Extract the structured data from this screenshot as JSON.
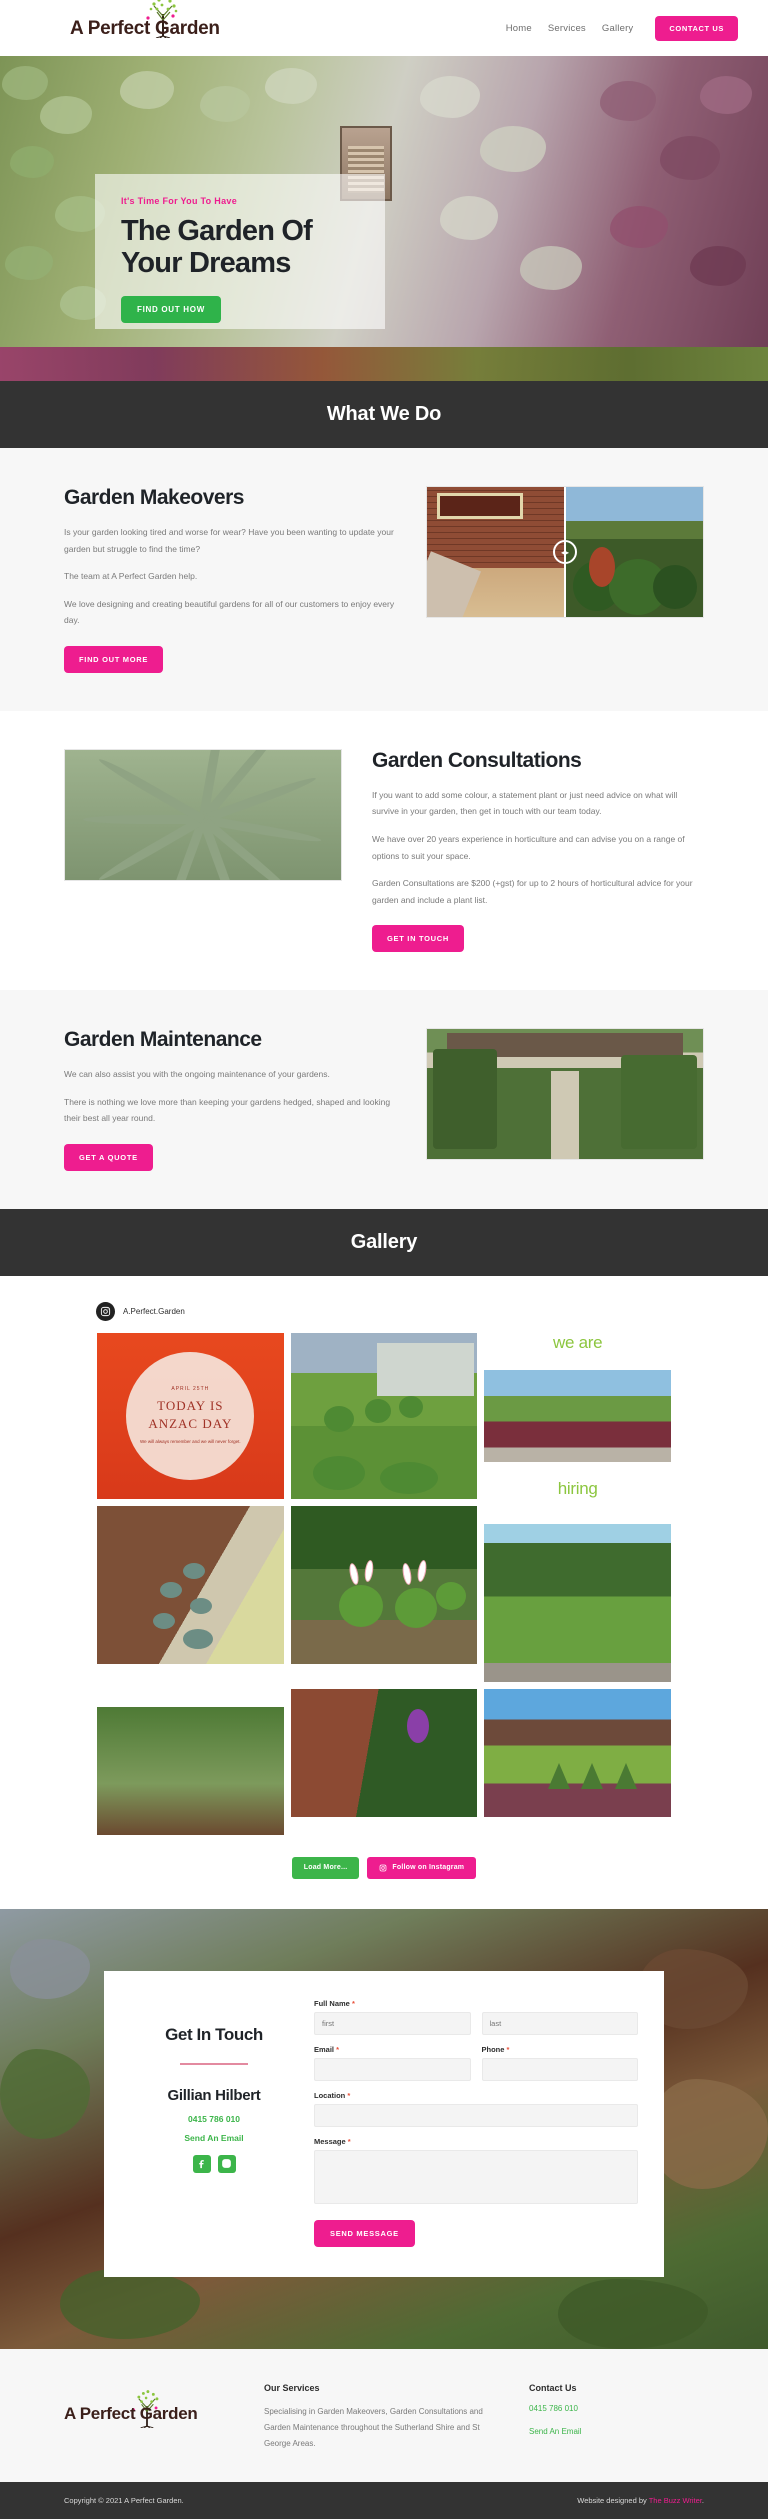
{
  "header": {
    "logo_text": "A Perfect Garden",
    "logo_icon": "tree-icon",
    "nav": [
      {
        "label": "Home"
      },
      {
        "label": "Services"
      },
      {
        "label": "Gallery"
      }
    ],
    "cta_label": "CONTACT US"
  },
  "hero": {
    "kicker": "It's Time For You To Have",
    "title_line1": "The Garden Of",
    "title_line2": "Your Dreams",
    "button_label": "FIND OUT HOW"
  },
  "what_we_do": {
    "band_title": "What We Do",
    "services": [
      {
        "heading": "Garden Makeovers",
        "paragraphs": [
          "Is your garden looking tired and worse for wear? Have you been wanting to update your garden but struggle to find the time?",
          "The team at A Perfect Garden help.",
          "We love designing and creating beautiful gardens for all of our customers to enjoy every day."
        ],
        "button_label": "FIND OUT MORE",
        "media": "before-after-slider"
      },
      {
        "heading": "Garden Consultations",
        "paragraphs": [
          "If you want to add some colour, a statement plant or just need advice on what will survive in your garden, then get in touch with our team today.",
          "We have over 20 years experience in horticulture and can advise you on a range of options to suit your space.",
          "Garden Consultations are $200 (+gst) for up to 2 hours of horticultural advice for your garden and include a plant list."
        ],
        "button_label": "GET IN TOUCH",
        "media": "palm-photo"
      },
      {
        "heading": "Garden Maintenance",
        "paragraphs": [
          "We can also assist you with the ongoing maintenance of your gardens.",
          "There is nothing we love more than keeping your gardens hedged, shaped and looking their best all year round."
        ],
        "button_label": "GET A QUOTE",
        "media": "hedged-garden-photo"
      }
    ]
  },
  "gallery": {
    "band_title": "Gallery",
    "instagram_handle": "A.Perfect.Garden",
    "instagram_icon": "instagram-icon",
    "anzac_card": {
      "date": "APRIL 25TH",
      "title_line1": "TODAY IS",
      "title_line2": "ANZAC DAY",
      "subtitle": "We will always remember and we will never forget."
    },
    "hiring_card": {
      "line1": "we are",
      "line2": "hiring"
    },
    "load_more_label": "Load More...",
    "follow_label": "Follow on Instagram"
  },
  "contact": {
    "title": "Get In Touch",
    "name": "Gillian Hilbert",
    "phone": "0415 786 010",
    "email_label": "Send An Email",
    "social": [
      {
        "icon": "facebook-icon"
      },
      {
        "icon": "instagram-icon"
      }
    ],
    "form": {
      "full_name_label": "Full Name",
      "first_placeholder": "first",
      "last_placeholder": "last",
      "email_label": "Email",
      "phone_label": "Phone",
      "location_label": "Location",
      "message_label": "Message",
      "required_mark": "*",
      "submit_label": "SEND MESSAGE"
    }
  },
  "footer": {
    "logo_text": "A Perfect Garden",
    "services_heading": "Our Services",
    "services_text": "Specialising in Garden Makeovers, Garden Consultations and Garden Maintenance throughout the Sutherland Shire and St George Areas.",
    "contact_heading": "Contact Us",
    "phone": "0415 786 010",
    "email_label": "Send An Email",
    "copyright": "Copyright © 2021 A Perfect Garden.",
    "designed_prefix": "Website designed by ",
    "designer": "The Buzz Writer",
    "designed_suffix": "."
  },
  "colors": {
    "pink": "#ee1d8f",
    "green": "#3cb54a",
    "dark_band": "#333333"
  }
}
